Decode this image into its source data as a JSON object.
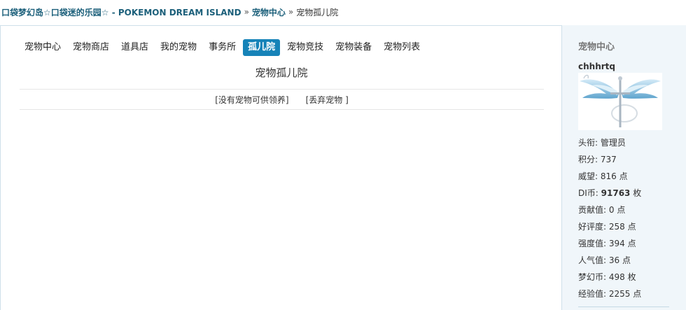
{
  "breadcrumb": {
    "site": "口袋梦幻岛☆口袋迷的乐园☆ - POKEMON DREAM ISLAND",
    "sep1": "»",
    "section": "宠物中心",
    "sep2": "»",
    "current": "宠物孤儿院"
  },
  "tabs": [
    {
      "label": "宠物中心"
    },
    {
      "label": "宠物商店"
    },
    {
      "label": "道具店"
    },
    {
      "label": "我的宠物"
    },
    {
      "label": "事务所"
    },
    {
      "label": "孤儿院"
    },
    {
      "label": "宠物竞技"
    },
    {
      "label": "宠物装备"
    },
    {
      "label": "宠物列表"
    }
  ],
  "active_tab": "孤儿院",
  "page_title": "宠物孤儿院",
  "actions": {
    "no_pet": "[没有宠物可供领养]",
    "abandon": "[丢弃宠物 ]"
  },
  "sidebar": {
    "heading": "宠物中心",
    "username": "chhhrtq",
    "avatar_icon": "winged-cross-icon",
    "stats": [
      {
        "label": "头衔: ",
        "value": "管理员",
        "unit": ""
      },
      {
        "label": "积分: ",
        "value": "737",
        "unit": ""
      },
      {
        "label": "威望: ",
        "value": "816",
        "unit": " 点"
      },
      {
        "label": "DI币: ",
        "value": "91763",
        "unit": " 枚"
      },
      {
        "label": "贡献值: ",
        "value": "0",
        "unit": " 点"
      },
      {
        "label": "好评度: ",
        "value": "258",
        "unit": " 点"
      },
      {
        "label": "强度值: ",
        "value": "394",
        "unit": " 点"
      },
      {
        "label": "人气值: ",
        "value": "36",
        "unit": " 点"
      },
      {
        "label": "梦幻币: ",
        "value": "498",
        "unit": " 枚"
      },
      {
        "label": "经验值: ",
        "value": "2255",
        "unit": " 点"
      }
    ]
  },
  "colors": {
    "link": "#1b5f7a",
    "active_tab_bg": "#1683b8",
    "sidebar_bg": "#f0f6fa"
  }
}
